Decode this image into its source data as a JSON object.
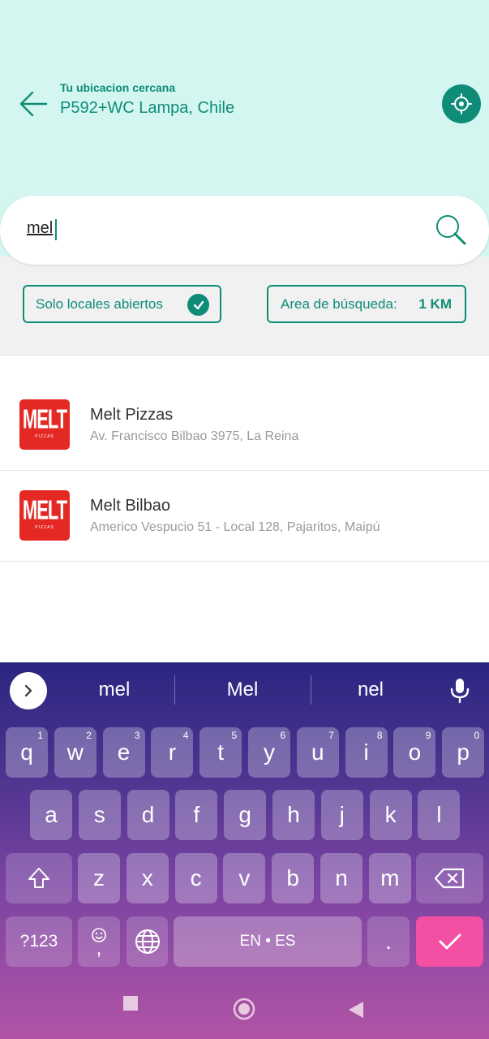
{
  "header": {
    "location_label": "Tu ubicacion cercana",
    "location_value": "P592+WC Lampa, Chile"
  },
  "search": {
    "value": "mel"
  },
  "filters": {
    "open_only_label": "Solo locales abiertos",
    "area_label": "Area de búsqueda:",
    "area_value": "1 KM"
  },
  "results": [
    {
      "logo": "MELT",
      "logo_sub": "PIZZAS",
      "name": "Melt Pizzas",
      "address": "Av. Francisco Bilbao 3975, La Reina"
    },
    {
      "logo": "MELT",
      "logo_sub": "PIZZAS",
      "name": "Melt Bilbao",
      "address": "Americo Vespucio 51 - Local 128, Pajaritos, Maipú"
    }
  ],
  "keyboard": {
    "suggestions": [
      "mel",
      "Mel",
      "nel"
    ],
    "row1": [
      "q",
      "w",
      "e",
      "r",
      "t",
      "y",
      "u",
      "i",
      "o",
      "p"
    ],
    "row1_hints": [
      "1",
      "2",
      "3",
      "4",
      "5",
      "6",
      "7",
      "8",
      "9",
      "0"
    ],
    "row2": [
      "a",
      "s",
      "d",
      "f",
      "g",
      "h",
      "j",
      "k",
      "l"
    ],
    "row3": [
      "z",
      "x",
      "c",
      "v",
      "b",
      "n",
      "m"
    ],
    "symbols_label": "?123",
    "comma_label": ",",
    "space_label": "EN • ES",
    "period_label": "."
  },
  "colors": {
    "accent": "#0f8c78",
    "header_bg": "#d3f6f1",
    "brand_logo": "#e42823",
    "enter_key": "#f34fa3"
  },
  "icons": [
    "back-arrow-icon",
    "gps-target-icon",
    "search-icon",
    "check-icon",
    "chevron-right-icon",
    "mic-icon",
    "shift-icon",
    "backspace-icon",
    "emoji-icon",
    "globe-icon",
    "enter-check-icon",
    "nav-recents-icon",
    "nav-home-icon",
    "nav-back-icon"
  ]
}
